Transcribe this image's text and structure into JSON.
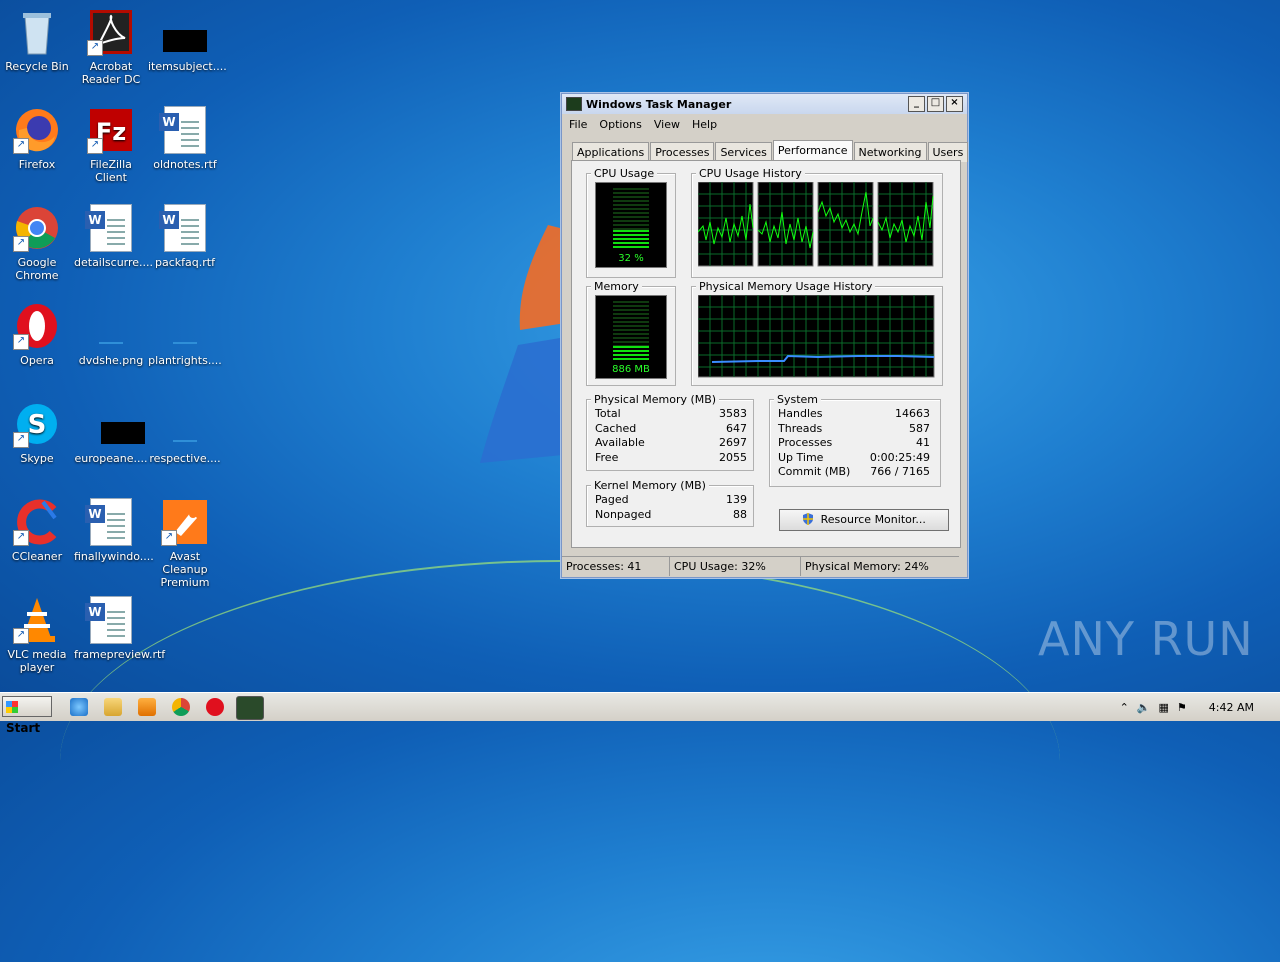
{
  "desktop": {
    "icons": [
      {
        "label": "Recycle Bin"
      },
      {
        "label": "Acrobat Reader DC"
      },
      {
        "label": "itemsubject...."
      },
      {
        "label": "Firefox"
      },
      {
        "label": "FileZilla Client"
      },
      {
        "label": "oldnotes.rtf"
      },
      {
        "label": "Google Chrome"
      },
      {
        "label": "detailscurre...."
      },
      {
        "label": "packfaq.rtf"
      },
      {
        "label": "Opera"
      },
      {
        "label": "dvdshe.png"
      },
      {
        "label": "plantrights...."
      },
      {
        "label": "Skype"
      },
      {
        "label": "europeane...."
      },
      {
        "label": "respective...."
      },
      {
        "label": "CCleaner"
      },
      {
        "label": "finallywindo...."
      },
      {
        "label": "Avast Cleanup Premium"
      },
      {
        "label": "VLC media player"
      },
      {
        "label": "framepreview.rtf"
      }
    ],
    "watermark": "ANY RUN"
  },
  "task_manager": {
    "title": "Windows Task Manager",
    "menu": [
      "File",
      "Options",
      "View",
      "Help"
    ],
    "tabs": [
      "Applications",
      "Processes",
      "Services",
      "Performance",
      "Networking",
      "Users"
    ],
    "active_tab": "Performance",
    "cpu_usage": {
      "label": "CPU Usage",
      "value": "32 %",
      "fraction": 0.32
    },
    "cpu_history": {
      "label": "CPU Usage History"
    },
    "memory": {
      "label": "Memory",
      "value": "886 MB",
      "fraction": 0.24
    },
    "memory_history": {
      "label": "Physical Memory Usage History"
    },
    "physical_memory": {
      "label": "Physical Memory (MB)",
      "rows": [
        {
          "name": "Total",
          "value": "3583"
        },
        {
          "name": "Cached",
          "value": "647"
        },
        {
          "name": "Available",
          "value": "2697"
        },
        {
          "name": "Free",
          "value": "2055"
        }
      ]
    },
    "kernel_memory": {
      "label": "Kernel Memory (MB)",
      "rows": [
        {
          "name": "Paged",
          "value": "139"
        },
        {
          "name": "Nonpaged",
          "value": "88"
        }
      ]
    },
    "system": {
      "label": "System",
      "rows": [
        {
          "name": "Handles",
          "value": "14663"
        },
        {
          "name": "Threads",
          "value": "587"
        },
        {
          "name": "Processes",
          "value": "41"
        },
        {
          "name": "Up Time",
          "value": "0:00:25:49"
        },
        {
          "name": "Commit (MB)",
          "value": "766 / 7165"
        }
      ]
    },
    "resource_monitor_button": "Resource Monitor...",
    "status": {
      "processes": "Processes: 41",
      "cpu": "CPU Usage: 32%",
      "memory": "Physical Memory: 24%"
    }
  },
  "taskbar": {
    "start_label": "Start",
    "clock": "4:42 AM"
  }
}
